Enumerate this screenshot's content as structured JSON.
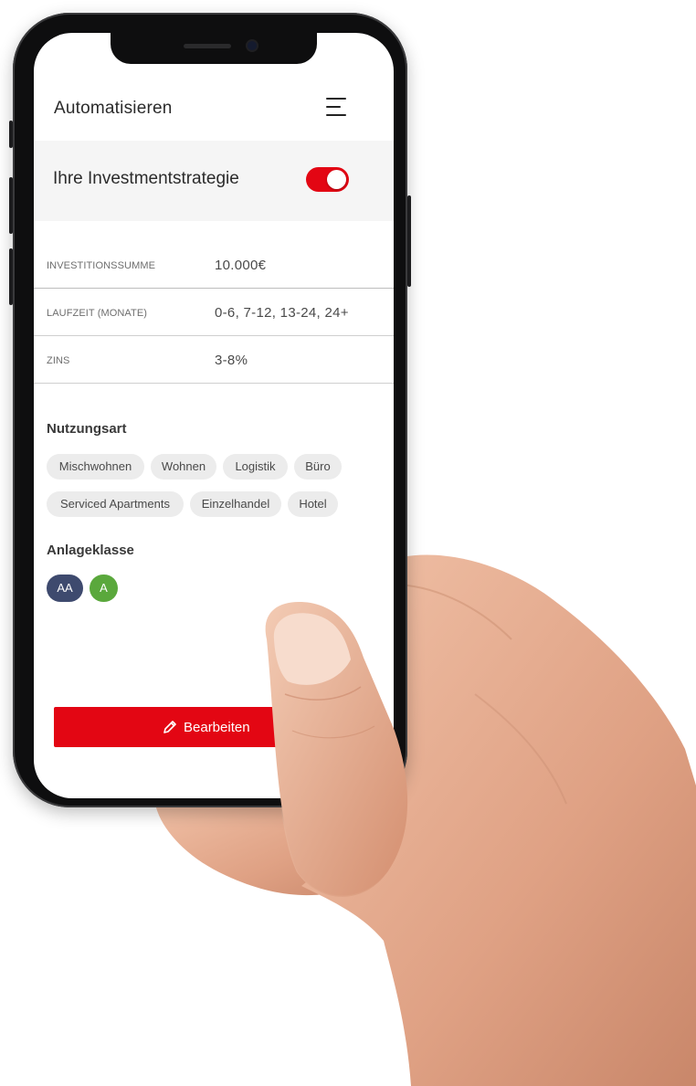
{
  "app": {
    "title": "Automatisieren"
  },
  "strategy": {
    "label": "Ihre Investmentstrategie",
    "enabled": true
  },
  "details": [
    {
      "key": "INVESTITIONSSUMME",
      "value": "10.000€"
    },
    {
      "key": "LAUFZEIT (MONATE)",
      "value": "0-6, 7-12, 13-24, 24+"
    },
    {
      "key": "ZINS",
      "value": "3-8%"
    }
  ],
  "usage": {
    "title": "Nutzungsart",
    "chips": [
      "Mischwohnen",
      "Wohnen",
      "Logistik",
      "Büro",
      "Serviced Apartments",
      "Einzelhandel",
      "Hotel"
    ]
  },
  "asset_class": {
    "title": "Anlageklasse",
    "grades": [
      {
        "label": "AA",
        "color": "#3e4a6e"
      },
      {
        "label": "A",
        "color": "#5aa83c"
      }
    ]
  },
  "actions": {
    "edit_label": "Bearbeiten",
    "accent": "#e30613"
  }
}
